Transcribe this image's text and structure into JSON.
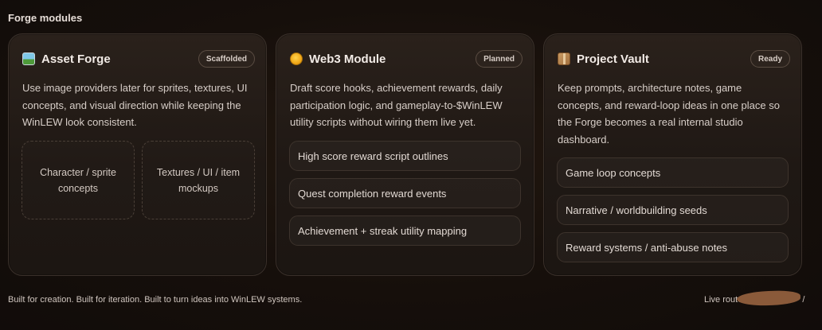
{
  "section": {
    "title": "Forge modules"
  },
  "cards": [
    {
      "icon": "framed-picture-icon",
      "title": "Asset Forge",
      "badge": "Scaffolded",
      "description": "Use image providers later for sprites, textures, UI concepts, and visual direction while keeping the WinLEW look consistent.",
      "tiles": [
        "Character / sprite concepts",
        "Textures / UI / item mockups"
      ]
    },
    {
      "icon": "coin-icon",
      "title": "Web3 Module",
      "badge": "Planned",
      "description": "Draft score hooks, achievement rewards, daily participation logic, and gameplay-to-$WinLEW utility scripts without wiring them live yet.",
      "items": [
        "High score reward script outlines",
        "Quest completion reward events",
        "Achievement + streak utility mapping"
      ]
    },
    {
      "icon": "package-icon",
      "title": "Project Vault",
      "badge": "Ready",
      "description": "Keep prompts, architecture notes, game concepts, and reward-loop ideas in one place so the Forge becomes a real internal studio dashboard.",
      "items": [
        "Game loop concepts",
        "Narrative / worldbuilding seeds",
        "Reward systems / anti-abuse notes"
      ]
    }
  ],
  "footer": {
    "tagline": "Built for creation. Built for iteration. Built to turn ideas into WinLEW systems.",
    "route_label": "Live route",
    "route_suffix": "/"
  },
  "colors": {
    "background": "#120d0b",
    "card": "#231b16",
    "border": "#3a302a",
    "text": "#e9e1dc"
  }
}
